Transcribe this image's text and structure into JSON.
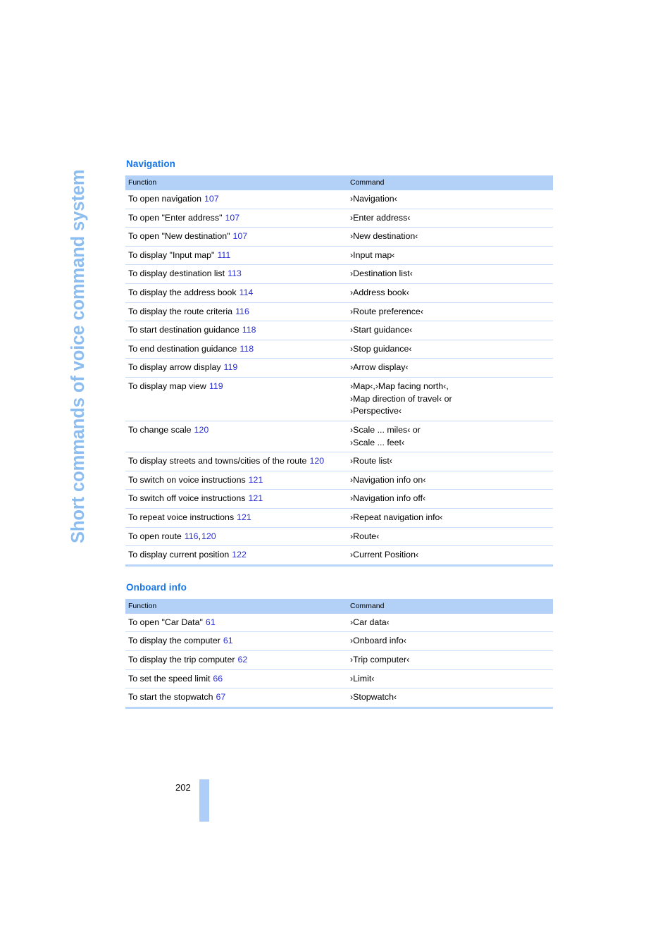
{
  "sidebar": {
    "chapter_title": "Short commands of voice command system",
    "color": "#8cbdf0"
  },
  "footer": {
    "page_number": "202",
    "bar_color": "#aecdf7"
  },
  "colors": {
    "heading_blue": "#1575ea",
    "pageref_blue": "#2a2fd0",
    "table_header_bg": "#b3d1f7",
    "row_rule": "#c8dcf5",
    "table_bottom_rule": "#b9d5f7"
  },
  "sections": [
    {
      "heading": "Navigation",
      "columns": [
        "Function",
        "Command"
      ],
      "rows": [
        {
          "function": "To open navigation",
          "refs": "107",
          "command": "›Navigation‹"
        },
        {
          "function": "To open \"Enter address\"",
          "refs": "107",
          "command": "›Enter address‹"
        },
        {
          "function": "To open \"New destination\"",
          "refs": "107",
          "command": "›New destination‹"
        },
        {
          "function": "To display \"Input map\"",
          "refs": "111",
          "command": "›Input map‹"
        },
        {
          "function": "To display destination list",
          "refs": "113",
          "command": "›Destination list‹"
        },
        {
          "function": "To display the address book",
          "refs": "114",
          "command": "›Address book‹"
        },
        {
          "function": "To display the route criteria",
          "refs": "116",
          "command": "›Route preference‹"
        },
        {
          "function": "To start destination guidance",
          "refs": "118",
          "command": "›Start guidance‹"
        },
        {
          "function": "To end destination guidance",
          "refs": "118",
          "command": "›Stop guidance‹"
        },
        {
          "function": "To display arrow display",
          "refs": "119",
          "command": "›Arrow display‹"
        },
        {
          "function": "To display map view",
          "refs": "119",
          "command": "›Map‹,›Map facing north‹,\n›Map direction of travel‹ or\n›Perspective‹"
        },
        {
          "function": "To change scale",
          "refs": "120",
          "command": "›Scale ... miles‹ or\n›Scale ... feet‹"
        },
        {
          "function": "To display streets and towns/cities of the route",
          "refs": "120",
          "command": "›Route list‹"
        },
        {
          "function": "To switch on voice instructions",
          "refs": "121",
          "command": "›Navigation info on‹"
        },
        {
          "function": "To switch off voice instructions",
          "refs": "121",
          "command": "›Navigation info off‹"
        },
        {
          "function": "To repeat voice instructions",
          "refs": "121",
          "command": "›Repeat navigation info‹"
        },
        {
          "function": "To open route",
          "refs": "116",
          "refs_extra": "120",
          "command": "›Route‹"
        },
        {
          "function": "To display current position",
          "refs": "122",
          "command": "›Current Position‹"
        }
      ]
    },
    {
      "heading": "Onboard info",
      "columns": [
        "Function",
        "Command"
      ],
      "rows": [
        {
          "function": "To open \"Car Data\"",
          "refs": "61",
          "command": "›Car data‹"
        },
        {
          "function": "To display the computer",
          "refs": "61",
          "command": "›Onboard info‹"
        },
        {
          "function": "To display the trip computer",
          "refs": "62",
          "command": "›Trip computer‹"
        },
        {
          "function": "To set the speed limit",
          "refs": "66",
          "command": "›Limit‹"
        },
        {
          "function": "To start the stopwatch",
          "refs": "67",
          "command": "›Stopwatch‹"
        }
      ]
    }
  ]
}
